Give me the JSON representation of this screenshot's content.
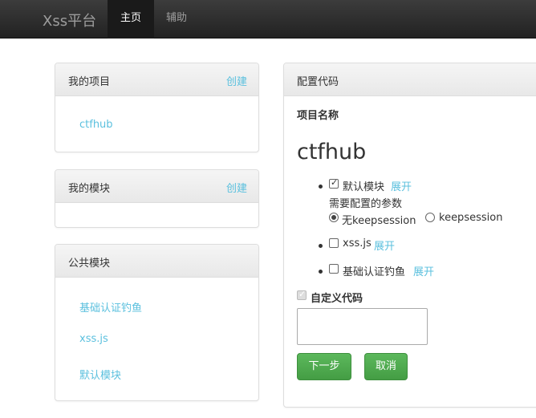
{
  "navbar": {
    "brand": "Xss平台",
    "home": "主页",
    "help": "辅助"
  },
  "projects": {
    "title": "我的项目",
    "create": "创建",
    "items": [
      "ctfhub"
    ]
  },
  "modules": {
    "title": "我的模块",
    "create": "创建"
  },
  "public_modules": {
    "title": "公共模块",
    "items": [
      "基础认证钓鱼",
      "xss.js",
      "默认模块"
    ]
  },
  "config": {
    "title": "配置代码",
    "project_name_label": "项目名称",
    "project_name": "ctfhub",
    "modules": [
      {
        "label": "默认模块",
        "checked": true,
        "expand": "展开"
      },
      {
        "label": "xss.js",
        "checked": false,
        "expand": "展开"
      },
      {
        "label": "基础认证钓鱼",
        "checked": false,
        "expand": "展开"
      }
    ],
    "params_label": "需要配置的参数",
    "radio_options": [
      "无keepsession",
      "keepsession"
    ],
    "custom_code_label": "自定义代码",
    "next_button": "下一步",
    "cancel_button": "取消"
  }
}
